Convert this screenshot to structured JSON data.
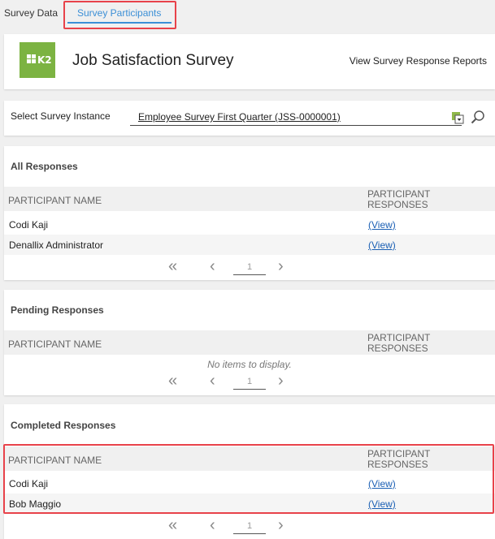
{
  "tabs": [
    {
      "label": "Survey Data"
    },
    {
      "label": "Survey Participants"
    }
  ],
  "header": {
    "logo_text": "K2",
    "title": "Job Satisfaction Survey",
    "report_link": "View Survey Response Reports"
  },
  "select": {
    "label": "Select Survey Instance",
    "value": "Employee Survey First Quarter (JSS-0000001)"
  },
  "all_responses": {
    "title": "All Responses",
    "col_name": "PARTICIPANT NAME",
    "col_responses": "PARTICIPANT RESPONSES",
    "rows": [
      {
        "name": "Codi Kaji",
        "link": "(View)"
      },
      {
        "name": "Denallix Administrator",
        "link": "(View)"
      }
    ],
    "page": "1"
  },
  "pending_responses": {
    "title": "Pending Responses",
    "col_name": "PARTICIPANT NAME",
    "col_responses": "PARTICIPANT RESPONSES",
    "empty_text": "No items to display.",
    "page": "1"
  },
  "completed_responses": {
    "title": "Completed Responses",
    "col_name": "PARTICIPANT NAME",
    "col_responses": "PARTICIPANT RESPONSES",
    "rows": [
      {
        "name": "Codi Kaji",
        "link": "(View)"
      },
      {
        "name": "Bob Maggio",
        "link": "(View)"
      }
    ],
    "page": "1"
  },
  "pager_glyphs": {
    "first": "«",
    "prev": "‹",
    "next": "›"
  },
  "colors": {
    "accent": "#3b8fd6",
    "logo": "#7cb342",
    "highlight": "#e8424a",
    "link": "#1a5fb4"
  }
}
